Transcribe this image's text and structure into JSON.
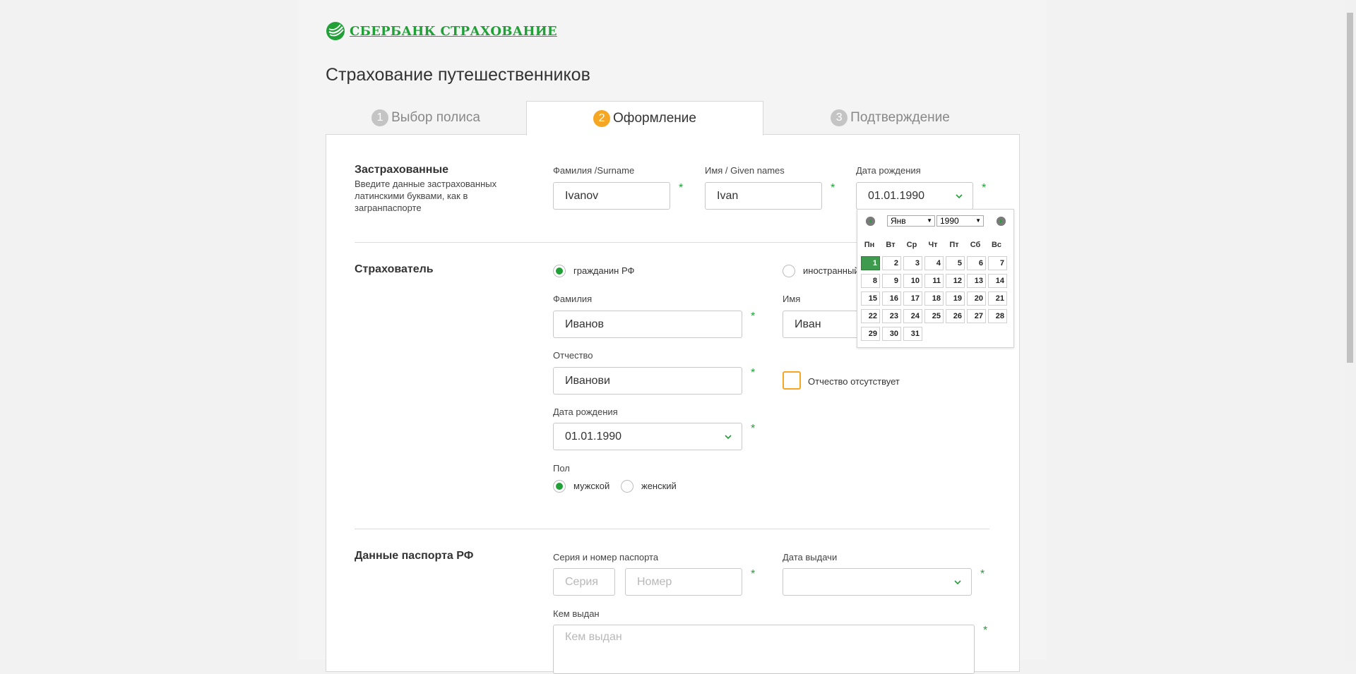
{
  "brand": {
    "logo_text": "СБЕРБАНК СТРАХОВАНИЕ",
    "color": "#21a038"
  },
  "page_title": "Страхование путешественников",
  "tabs": [
    {
      "num": "1",
      "label": "Выбор полиса"
    },
    {
      "num": "2",
      "label": "Оформление"
    },
    {
      "num": "3",
      "label": "Подтверждение"
    }
  ],
  "insured": {
    "title": "Застрахованные",
    "description": "Введите данные застрахованных латинскими буквами, как в загранпаспорте",
    "surname_label": "Фамилия /Surname",
    "surname_value": "Ivanov",
    "given_label": "Имя / Given names",
    "given_value": "Ivan",
    "dob_label": "Дата рождения",
    "dob_value": "01.01.1990"
  },
  "policyholder": {
    "title": "Страхователь",
    "radio_rf": "гражданин РФ",
    "radio_foreign": "иностранный",
    "surname_label": "Фамилия",
    "surname_value": "Иванов",
    "name_label": "Имя",
    "name_value": "Иван",
    "patronymic_label": "Отчество",
    "patronymic_value": "Иванови",
    "no_patronymic_label": "Отчество отсутствует",
    "dob_label": "Дата рождения",
    "dob_value": "01.01.1990",
    "gender_label": "Пол",
    "gender_male": "мужской",
    "gender_female": "женский"
  },
  "passport": {
    "title": "Данные паспорта РФ",
    "number_label": "Серия и номер паспорта",
    "series_placeholder": "Серия",
    "number_placeholder": "Номер",
    "issue_date_label": "Дата выдачи",
    "issued_by_label": "Кем выдан",
    "issued_by_placeholder": "Кем выдан"
  },
  "required_mark": "*",
  "datepicker": {
    "month": "Янв",
    "year": "1990",
    "weekdays": [
      "Пн",
      "Вт",
      "Ср",
      "Чт",
      "Пт",
      "Сб",
      "Вс"
    ],
    "weeks": [
      [
        "1",
        "2",
        "3",
        "4",
        "5",
        "6",
        "7"
      ],
      [
        "8",
        "9",
        "10",
        "11",
        "12",
        "13",
        "14"
      ],
      [
        "15",
        "16",
        "17",
        "18",
        "19",
        "20",
        "21"
      ],
      [
        "22",
        "23",
        "24",
        "25",
        "26",
        "27",
        "28"
      ],
      [
        "29",
        "30",
        "31",
        "",
        "",
        "",
        ""
      ]
    ],
    "selected": "1"
  }
}
